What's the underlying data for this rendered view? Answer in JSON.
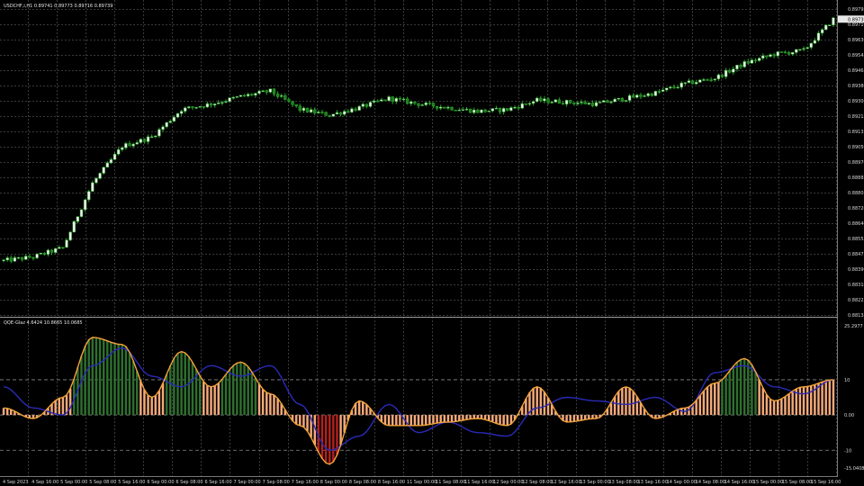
{
  "colors": {
    "background": "#000000",
    "grid": "#3a3a3a",
    "panel_separator": "#9a9a9a",
    "bull_body": "#f0f0f0",
    "bear_body": "#1f7f1f",
    "wick": "#2aa82a",
    "qqe_fast_line": "#f4a23a",
    "qqe_slow_line": "#2a2ab8",
    "histogram_positive_strong": "#2f6f2f",
    "histogram_positive_weak": "#f4a97a",
    "histogram_negative": "#f4a97a",
    "histogram_extreme_negative": "#b3201d",
    "level_line": "#8a8a8a"
  },
  "main_panel": {
    "header_text": "USDCHF,i,H1  0.89741 0.89773 0.89716 0.89739",
    "price_labels": [
      "0.89795",
      "0.89710",
      "0.89630",
      "0.89545",
      "0.89465",
      "0.89380",
      "0.89300",
      "0.89215",
      "0.89135",
      "0.89050",
      "0.88970",
      "0.88885",
      "0.88805",
      "0.88720",
      "0.88640",
      "0.88555",
      "0.88475",
      "0.88390",
      "0.88310",
      "0.88225",
      "0.88135"
    ],
    "current_price_label": "0.89739"
  },
  "sub_panel": {
    "header_text": "QQE-Glaz 4.6424 10.8665 10.0685",
    "scale_labels": [
      "25.2977",
      "10",
      "0.00",
      "-10",
      "-15.0408"
    ]
  },
  "time_axis": {
    "labels": [
      "4 Sep 2023",
      "4 Sep 16:00",
      "5 Sep 00:00",
      "5 Sep 08:00",
      "5 Sep 16:00",
      "6 Sep 00:00",
      "6 Sep 08:00",
      "6 Sep 16:00",
      "7 Sep 00:00",
      "7 Sep 08:00",
      "7 Sep 16:00",
      "8 Sep 00:00",
      "8 Sep 08:00",
      "8 Sep 16:00",
      "11 Sep 00:00",
      "11 Sep 08:00",
      "11 Sep 16:00",
      "12 Sep 00:00",
      "12 Sep 08:00",
      "12 Sep 16:00",
      "13 Sep 00:00",
      "13 Sep 08:00",
      "13 Sep 16:00",
      "14 Sep 00:00",
      "14 Sep 08:00",
      "14 Sep 16:00",
      "15 Sep 00:00",
      "15 Sep 08:00",
      "15 Sep 16:00"
    ]
  },
  "chart_data": [
    {
      "type": "candlestick",
      "title": "USDCHF,i,H1",
      "ohlc_header": {
        "open": 0.89741,
        "high": 0.89773,
        "low": 0.89716,
        "close": 0.89739
      },
      "ylim": [
        0.88135,
        0.89795
      ],
      "x": [
        "4 Sep 2023",
        "4 Sep 16:00",
        "5 Sep 00:00",
        "5 Sep 08:00",
        "5 Sep 16:00",
        "6 Sep 00:00",
        "6 Sep 08:00",
        "6 Sep 16:00",
        "7 Sep 00:00",
        "7 Sep 08:00",
        "7 Sep 16:00",
        "8 Sep 00:00",
        "8 Sep 08:00",
        "8 Sep 16:00",
        "11 Sep 00:00",
        "11 Sep 08:00",
        "11 Sep 16:00",
        "12 Sep 00:00",
        "12 Sep 08:00",
        "12 Sep 16:00",
        "13 Sep 00:00",
        "13 Sep 08:00",
        "13 Sep 16:00",
        "14 Sep 00:00",
        "14 Sep 08:00",
        "14 Sep 16:00",
        "15 Sep 00:00",
        "15 Sep 08:00",
        "15 Sep 16:00"
      ],
      "close": [
        0.8843,
        0.8845,
        0.885,
        0.8885,
        0.8905,
        0.891,
        0.8925,
        0.8928,
        0.8932,
        0.8935,
        0.8925,
        0.8922,
        0.8926,
        0.8931,
        0.8928,
        0.8926,
        0.8924,
        0.8925,
        0.893,
        0.8929,
        0.8928,
        0.8931,
        0.8934,
        0.8939,
        0.8942,
        0.895,
        0.8955,
        0.8957,
        0.8974
      ]
    },
    {
      "type": "line",
      "title": "QQE-Glaz 4.6424 10.8665 10.0685",
      "ylim": [
        -15.0408,
        25.2977
      ],
      "levels": [
        10,
        0,
        -10
      ],
      "x": [
        "4 Sep 2023",
        "4 Sep 16:00",
        "5 Sep 00:00",
        "5 Sep 08:00",
        "5 Sep 16:00",
        "6 Sep 00:00",
        "6 Sep 08:00",
        "6 Sep 16:00",
        "7 Sep 00:00",
        "7 Sep 08:00",
        "7 Sep 16:00",
        "8 Sep 00:00",
        "8 Sep 08:00",
        "8 Sep 16:00",
        "11 Sep 00:00",
        "11 Sep 08:00",
        "11 Sep 16:00",
        "12 Sep 00:00",
        "12 Sep 08:00",
        "12 Sep 16:00",
        "13 Sep 00:00",
        "13 Sep 08:00",
        "13 Sep 16:00",
        "14 Sep 00:00",
        "14 Sep 08:00",
        "14 Sep 16:00",
        "15 Sep 00:00",
        "15 Sep 08:00",
        "15 Sep 16:00"
      ],
      "series": [
        {
          "values": [
            2,
            -1,
            5,
            22,
            20,
            5,
            18,
            8,
            15,
            6,
            -3,
            -14,
            4,
            -3,
            -3,
            -2,
            -1,
            -3,
            8,
            -2,
            -1,
            8,
            -1,
            2,
            9,
            16,
            4,
            8,
            10
          ]
        },
        {
          "values": [
            8,
            2,
            0,
            14,
            19,
            11,
            8,
            14,
            11,
            14,
            3,
            -10,
            -6,
            3,
            -5,
            -2,
            -5,
            -6,
            2,
            5,
            4,
            3,
            5,
            1,
            12,
            14,
            8,
            6,
            10
          ]
        }
      ]
    }
  ]
}
